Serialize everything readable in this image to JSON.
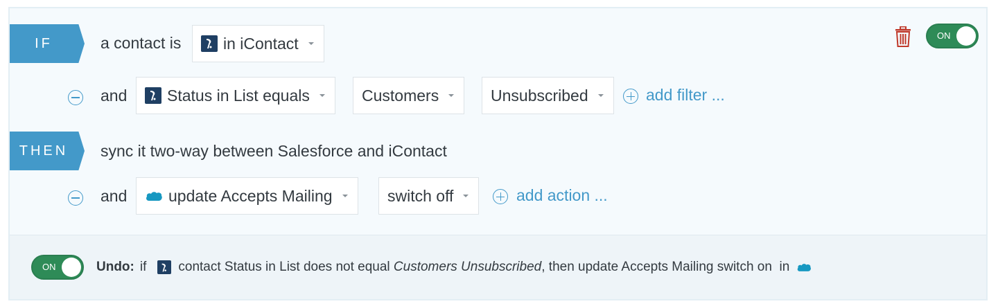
{
  "if_block": {
    "tag": "IF",
    "lead_text": "a contact is",
    "source_dropdown": "in iContact",
    "filter_and": "and",
    "filter_field_dropdown": "Status in List equals",
    "filter_list_dropdown": "Customers",
    "filter_value_dropdown": "Unsubscribed",
    "add_filter_label": "add filter ..."
  },
  "then_block": {
    "tag": "THEN",
    "action_text": "sync it two-way between Salesforce and iContact",
    "action_and": "and",
    "action_field_dropdown": "update Accepts Mailing",
    "action_value_dropdown": "switch off",
    "add_action_label": "add action ..."
  },
  "rule_toggle": {
    "label": "ON",
    "state": "on"
  },
  "undo": {
    "toggle_label": "ON",
    "label": "Undo:",
    "text_if": "if",
    "text_condition": "contact Status in List does not equal",
    "text_values": "Customers Unsubscribed",
    "text_then": ", then update Accepts Mailing switch on",
    "text_in": "in"
  },
  "icons": {
    "icontact": "icontact-logo-icon",
    "salesforce": "salesforce-cloud-icon",
    "delete": "trash-icon",
    "remove": "minus-circle-icon",
    "add": "plus-circle-icon"
  },
  "colors": {
    "accent": "#4399c9",
    "toggle_on": "#2e8b57",
    "delete": "#c0392b",
    "icontact_logo": "#1f3f63",
    "salesforce_logo": "#1798c1"
  }
}
